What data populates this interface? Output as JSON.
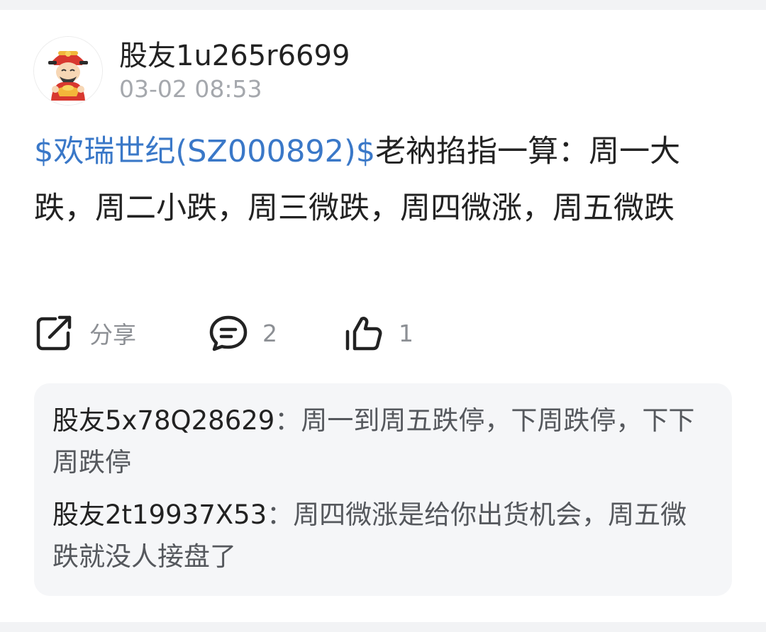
{
  "post": {
    "author": "股友1u265r6699",
    "time": "03-02 08:53",
    "stock_tag": "$欢瑞世纪(SZ000892)$",
    "body": "老衲掐指一算：周一大跌，周二小跌，周三微跌，周四微涨，周五微跌"
  },
  "actions": {
    "share_label": "分享",
    "comment_count": "2",
    "like_count": "1"
  },
  "comments": [
    {
      "user": "股友5x78Q28629",
      "sep": "：",
      "text": "周一到周五跌停，下周跌停，下下周跌停"
    },
    {
      "user": "股友2t19937X53",
      "sep": "：",
      "text": "周四微涨是给你出货机会，周五微跌就没人接盘了"
    }
  ],
  "icons": {
    "avatar": "caishen-avatar",
    "share": "share-icon",
    "comment": "comment-icon",
    "like": "thumbs-up-icon"
  },
  "colors": {
    "stock_link": "#3a78c8",
    "text": "#222222",
    "muted": "#a5a8ad",
    "comment_bg": "#f5f6f8"
  }
}
